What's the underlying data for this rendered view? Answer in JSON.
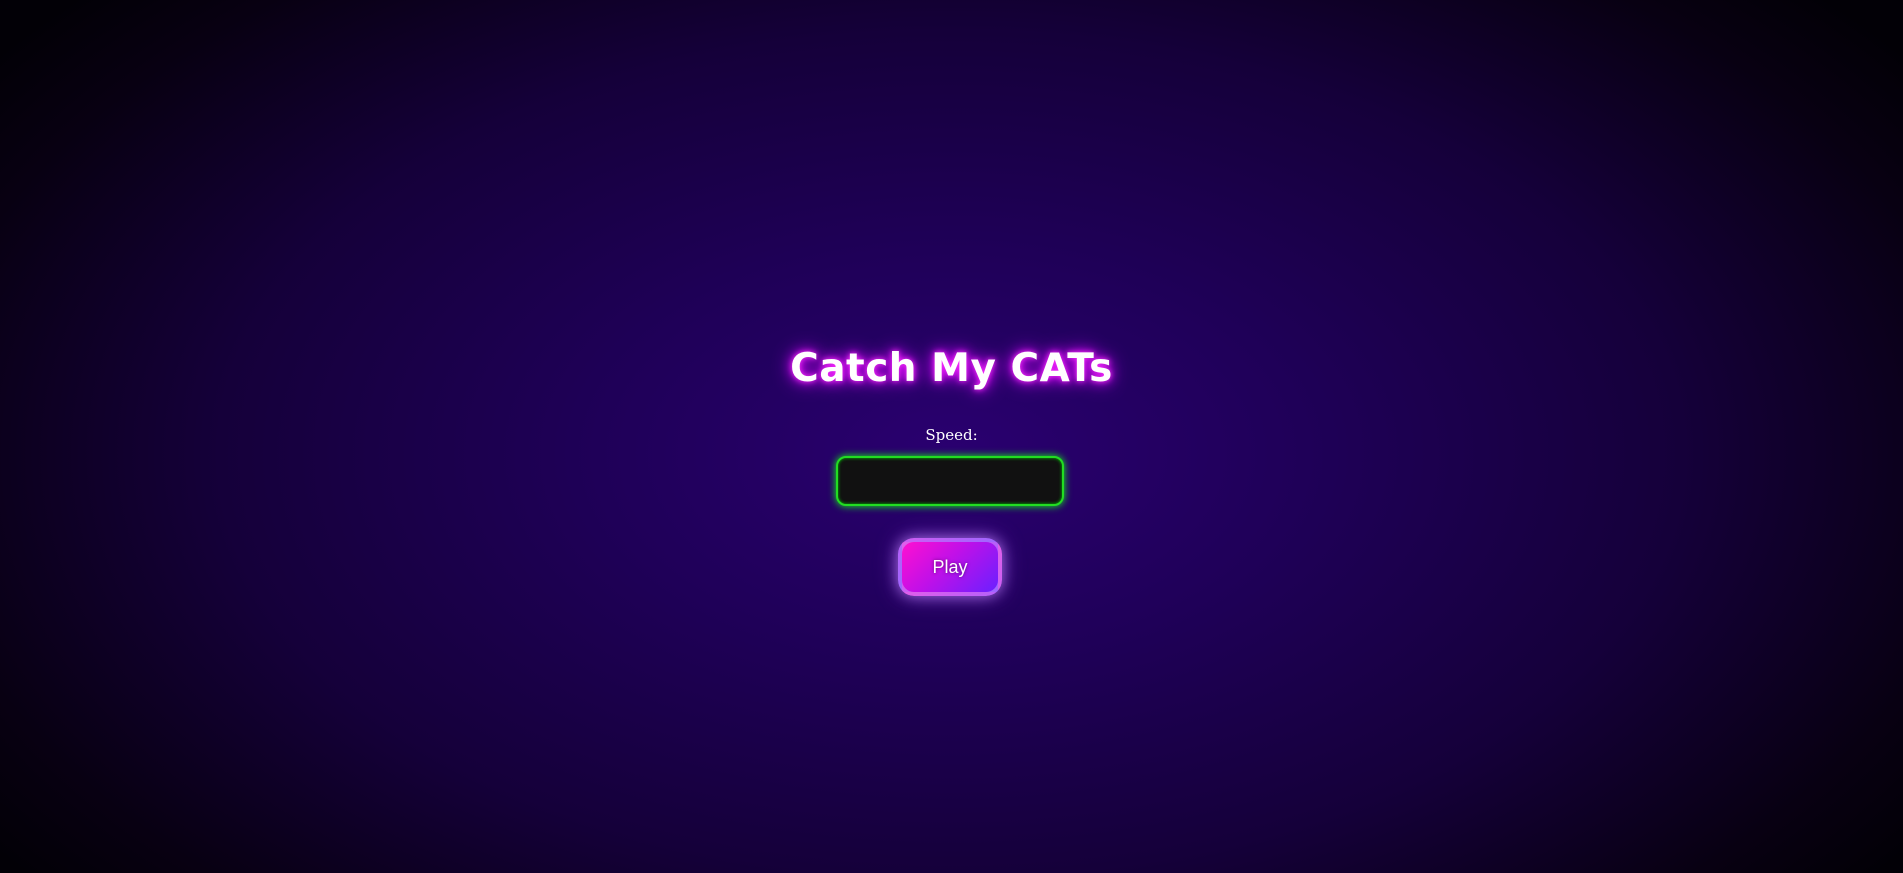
{
  "game": {
    "title": "Catch My CATs",
    "speed_label": "Speed:",
    "speed_input": {
      "value": "",
      "placeholder": ""
    },
    "play_label": "Play"
  },
  "colors": {
    "background": "#1f0058",
    "title_glow": "#e000ff",
    "input_border": "#22dd22",
    "input_background": "#111111",
    "button_gradient_start": "#ff10d0",
    "button_gradient_end": "#6a20ff"
  }
}
